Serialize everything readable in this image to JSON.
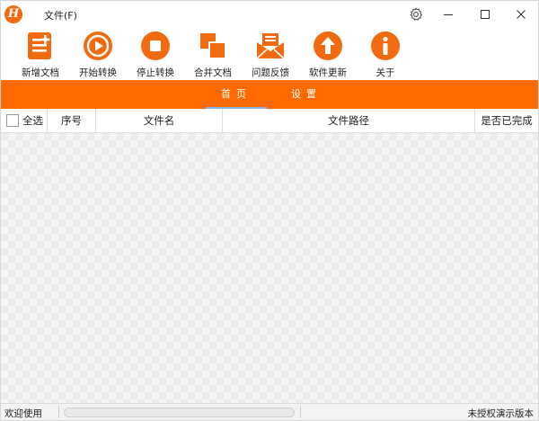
{
  "app": {
    "logo_letter": "H",
    "menu_file": "文件(F)"
  },
  "toolbar": {
    "items": [
      {
        "label": "新增文档",
        "icon": "add-doc-icon"
      },
      {
        "label": "开始转换",
        "icon": "play-icon"
      },
      {
        "label": "停止转换",
        "icon": "stop-icon"
      },
      {
        "label": "合并文档",
        "icon": "merge-icon"
      },
      {
        "label": "问题反馈",
        "icon": "mail-icon"
      },
      {
        "label": "软件更新",
        "icon": "upload-icon"
      },
      {
        "label": "关于",
        "icon": "info-icon"
      }
    ]
  },
  "tabs": [
    {
      "label": "首页",
      "active": true
    },
    {
      "label": "设置",
      "active": false
    }
  ],
  "table": {
    "select_all": "全选",
    "columns": [
      "序号",
      "文件名",
      "文件路径",
      "是否已完成"
    ],
    "rows": []
  },
  "status": {
    "left": "欢迎使用",
    "progress": 0,
    "right": "未授权演示版本"
  },
  "colors": {
    "accent": "#ff6a00",
    "tab_underline": "#8ab7e8"
  }
}
